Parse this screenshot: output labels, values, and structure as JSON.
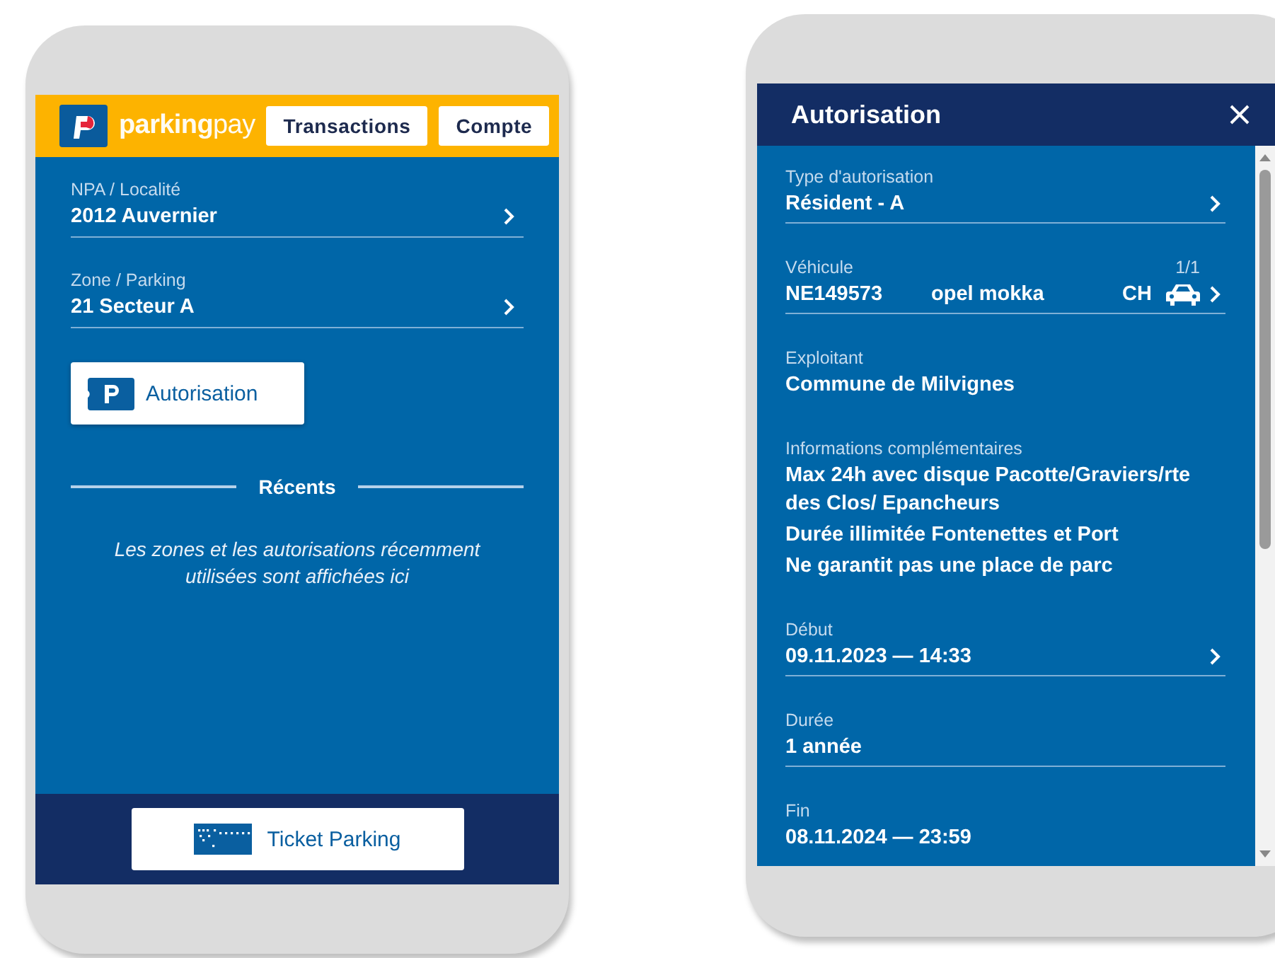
{
  "main_screen": {
    "logo_text": "**parking**pay",
    "nav_buttons": [
      "Transactions",
      "Compte"
    ],
    "fields": [
      {
        "label": "NPA / Localité",
        "value": "2012 Auvernier",
        "chevron": true
      },
      {
        "label": "Zone / Parking",
        "value": "21 Secteur A",
        "chevron": true
      }
    ],
    "authorization_button": "Autorisation",
    "recents": {
      "title": "Récents",
      "message": "Les zones et les autorisations récemment utilisées sont affichées ici"
    },
    "ticket_button": "Ticket Parking"
  },
  "authorization_screen": {
    "title": "Autorisation",
    "fields": [
      {
        "kind": "text",
        "label": "Type d'autorisation",
        "lines": [
          "Résident - A"
        ],
        "chevron": true,
        "underlined": true
      },
      {
        "kind": "vehicle",
        "label": "Véhicule",
        "count": "1/1",
        "plate": "NE149573",
        "model": "opel mokka",
        "country": "CH",
        "chevron": true,
        "underlined": true
      },
      {
        "kind": "text",
        "label": "Exploitant",
        "lines": [
          "Commune de Milvignes"
        ],
        "chevron": false,
        "underlined": false
      },
      {
        "kind": "text",
        "label": "Informations complémentaires",
        "lines": [
          "Max 24h avec disque Pacotte/Graviers/rte des Clos/ Epancheurs",
          "Durée illimitée Fontenettes et Port",
          "Ne garantit pas une place de parc"
        ],
        "chevron": false,
        "underlined": false
      },
      {
        "kind": "text",
        "label": "Début",
        "lines": [
          "09.11.2023 — 14:33"
        ],
        "chevron": true,
        "underlined": true
      },
      {
        "kind": "text",
        "label": "Durée",
        "lines": [
          "1 année"
        ],
        "chevron": false,
        "underlined": true
      },
      {
        "kind": "text",
        "label": "Fin",
        "lines": [
          "08.11.2024 — 23:59"
        ],
        "chevron": false,
        "underlined": false
      }
    ]
  }
}
